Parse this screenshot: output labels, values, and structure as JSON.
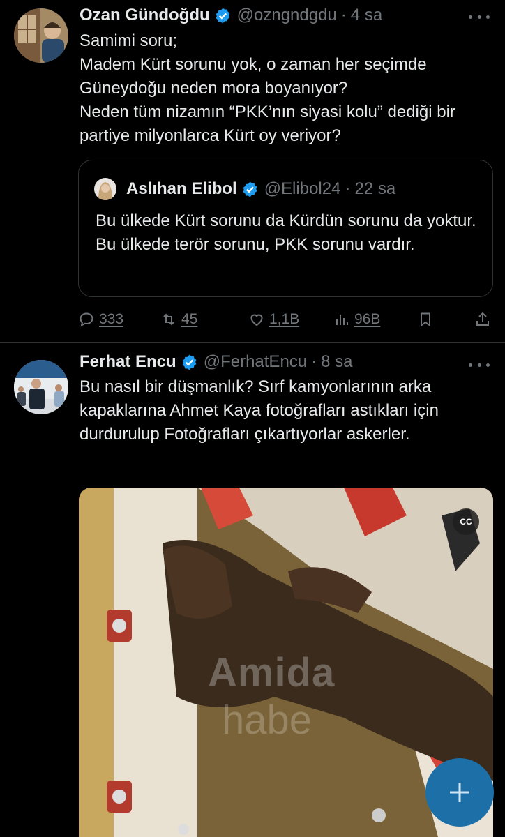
{
  "tweets": [
    {
      "author": "Ozan Gündoğdu",
      "handle": "@ozngndgdu",
      "time": "4 sa",
      "text": "Samimi soru;\nMadem Kürt sorunu yok, o zaman her seçimde Güneydoğu neden mora boyanıyor?\nNeden tüm nizamın “PKK’nın siyasi kolu” dediği bir partiye milyonlarca Kürt oy veriyor?",
      "quote": {
        "author": "Aslıhan Elibol",
        "handle": "@Elibol24",
        "time": "22 sa",
        "text": "Bu ülkede Kürt sorunu da Kürdün sorunu da yoktur. Bu ülkede terör sorunu, PKK sorunu vardır."
      },
      "actions": {
        "replies": "333",
        "retweets": "45",
        "likes": "1,1B",
        "views": "96B"
      }
    },
    {
      "author": "Ferhat Encu",
      "handle": "@FerhatEncu",
      "time": "8 sa",
      "text": "Bu nasıl bir düşmanlık? Sırf kamyonlarının arka kapaklarına Ahmet Kaya fotoğrafları astıkları için durdurulup Fotoğrafları çıkartıyorlar askerler.",
      "media": {
        "cc_label": "CC",
        "watermark_line1": "Amida",
        "watermark_line2": "habe"
      }
    }
  ],
  "separator": "·",
  "colors": {
    "background": "#000000",
    "text": "#e7e9ea",
    "muted": "#71767b",
    "verified": "#1d9bf0",
    "fab": "#1d6fa8"
  },
  "icons": {
    "verified": "verified-badge-icon",
    "more": "more-icon",
    "reply": "reply-icon",
    "retweet": "retweet-icon",
    "like": "heart-icon",
    "views": "views-icon",
    "bookmark": "bookmark-icon",
    "share": "share-icon",
    "compose": "plus-icon"
  }
}
